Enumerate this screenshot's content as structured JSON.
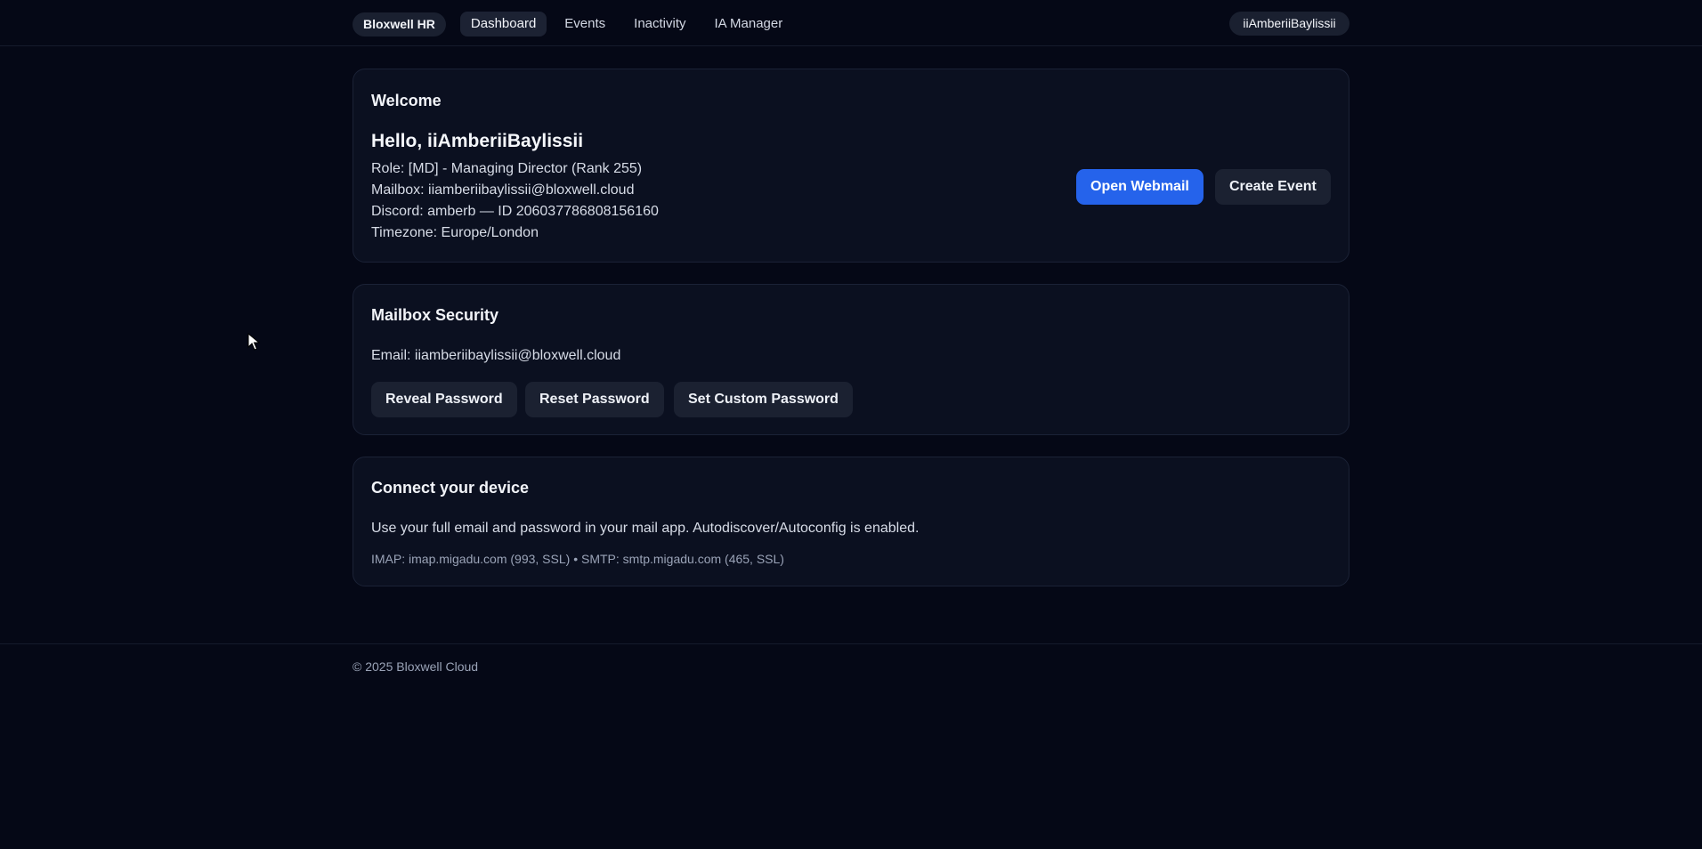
{
  "nav": {
    "brand": "Bloxwell HR",
    "links": [
      {
        "label": "Dashboard",
        "active": true
      },
      {
        "label": "Events",
        "active": false
      },
      {
        "label": "Inactivity",
        "active": false
      },
      {
        "label": "IA Manager",
        "active": false
      }
    ],
    "user": "iiAmberiiBaylissii"
  },
  "welcome": {
    "title": "Welcome",
    "hello": "Hello, iiAmberiiBaylissii",
    "role": "Role: [MD] - Managing Director (Rank 255)",
    "mailbox": "Mailbox: iiamberiibaylissii@bloxwell.cloud",
    "discord": "Discord: amberb — ID 206037786808156160",
    "timezone": "Timezone: Europe/London",
    "open_webmail_label": "Open Webmail",
    "create_event_label": "Create Event"
  },
  "security": {
    "title": "Mailbox Security",
    "email": "Email: iiamberiibaylissii@bloxwell.cloud",
    "reveal_label": "Reveal Password",
    "reset_label": "Reset Password",
    "custom_label": "Set Custom Password"
  },
  "device": {
    "title": "Connect your device",
    "description": "Use your full email and password in your mail app. Autodiscover/Autoconfig is enabled.",
    "servers": "IMAP: imap.migadu.com (993, SSL) • SMTP: smtp.migadu.com (465, SSL)"
  },
  "footer": {
    "copyright": "© 2025 Bloxwell Cloud"
  },
  "colors": {
    "background": "#050816",
    "card": "#0b1020",
    "accent": "#2563eb"
  }
}
